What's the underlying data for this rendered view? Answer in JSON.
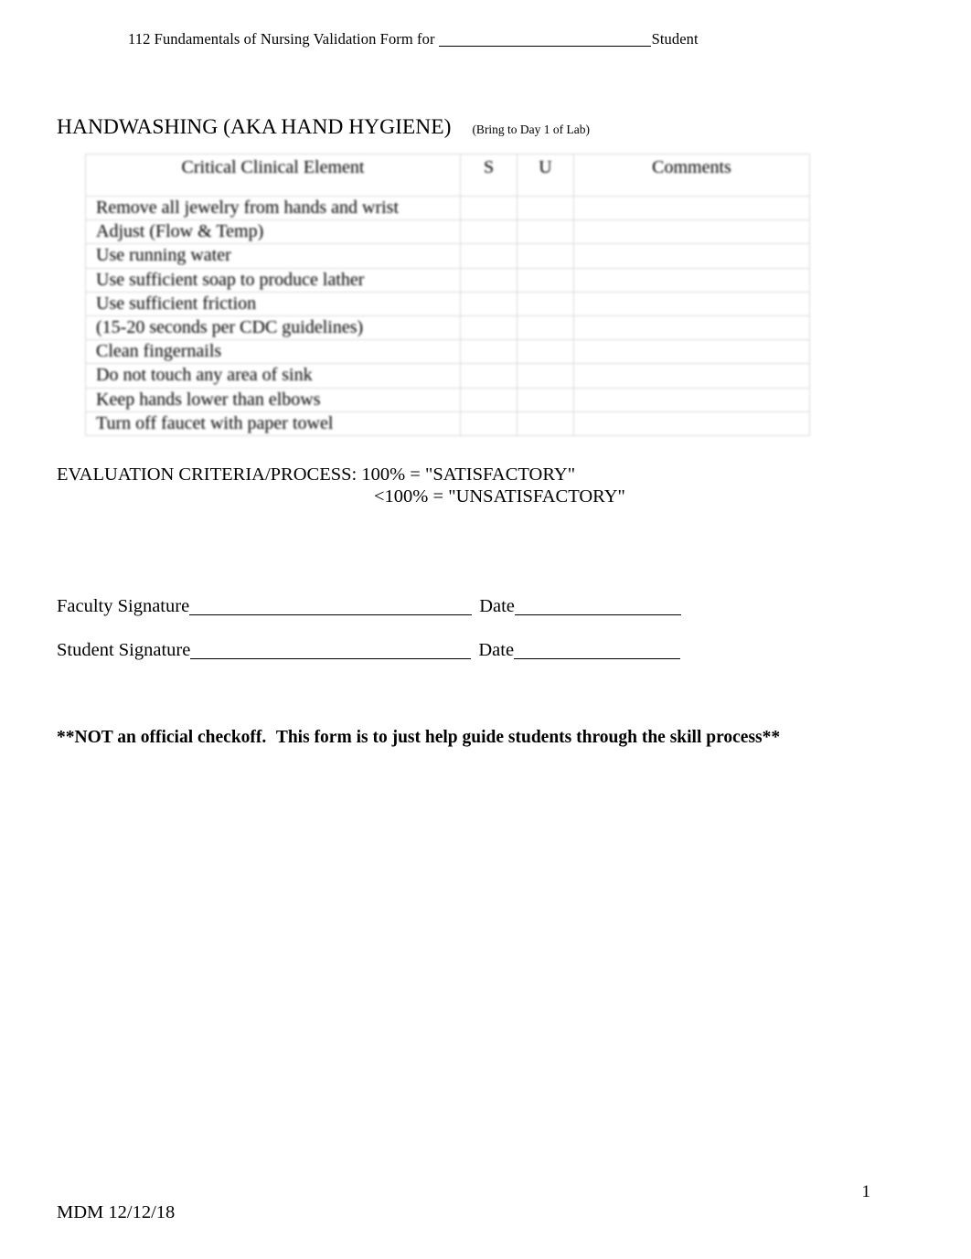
{
  "header": {
    "prefix": "112 Fundamentals of Nursing Validation Form for",
    "suffix": "Student"
  },
  "skill": {
    "title": "HANDWASHING (AKA HAND HYGIENE)",
    "note": "(Bring to Day 1 of Lab)",
    "highlight_color": "#ffff00"
  },
  "table": {
    "columns": [
      "Critical Clinical Element",
      "S",
      "U",
      "Comments"
    ],
    "rows": [
      "Remove all jewelry from hands and wrist",
      "Adjust (Flow & Temp)",
      "Use running water",
      "Use sufficient soap to produce lather",
      "Use sufficient friction",
      "(15-20 seconds per CDC guidelines)",
      "Clean fingernails",
      "Do not touch any area of sink",
      "Keep hands lower than elbows",
      "Turn off faucet with paper towel"
    ]
  },
  "evaluation": {
    "line1": "EVALUATION CRITERIA/PROCESS: 100% = \"SATISFACTORY\"",
    "line2": "<100% = \"UNSATISFACTORY\""
  },
  "signatures": {
    "faculty_label": "Faculty Signature",
    "student_label": "Student Signature",
    "date_label": "Date"
  },
  "bottom_note": {
    "highlighted": "**NOT an official checkoff.",
    "rest": " This form is to just help guide students through the skill process**"
  },
  "footer": {
    "author_date": "MDM 12/12/18",
    "page_number": "1"
  }
}
